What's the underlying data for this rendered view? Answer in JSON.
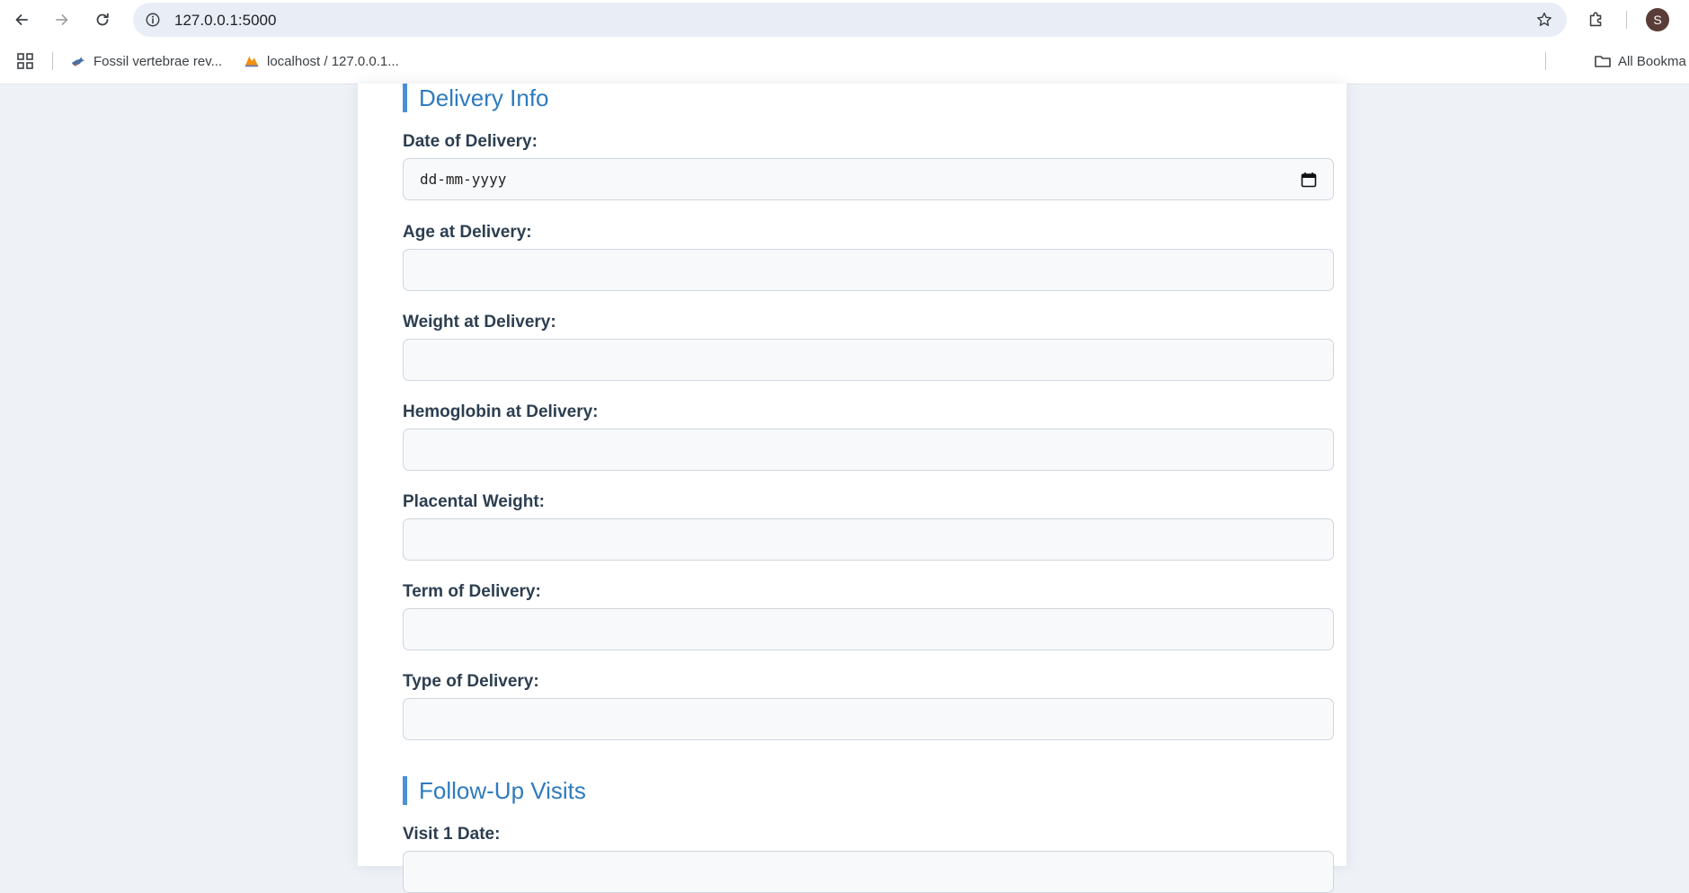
{
  "browser": {
    "url": "127.0.0.1:5000",
    "profile_initial": "S",
    "bookmarks": [
      {
        "label": "Fossil vertebrae rev...",
        "icon": "bird-favicon-icon"
      },
      {
        "label": "localhost / 127.0.0.1...",
        "icon": "phpmyadmin-favicon-icon"
      }
    ],
    "all_bookmarks_label": "All Bookma"
  },
  "form": {
    "sections": [
      {
        "title": "Delivery Info"
      },
      {
        "title": "Follow-Up Visits"
      }
    ],
    "fields": [
      {
        "label": "Date of Delivery:",
        "placeholder": "dd-mm-yyyy",
        "type": "date"
      },
      {
        "label": "Age at Delivery:"
      },
      {
        "label": "Weight at Delivery:"
      },
      {
        "label": "Hemoglobin at Delivery:"
      },
      {
        "label": "Placental Weight:"
      },
      {
        "label": "Term of Delivery:"
      },
      {
        "label": "Type of Delivery:"
      },
      {
        "label": "Visit 1 Date:"
      }
    ]
  },
  "colors": {
    "accent": "#2e7bbf",
    "accent_bar": "#4a90d9",
    "label_text": "#2c3e50",
    "page_background": "#eef2f7"
  }
}
